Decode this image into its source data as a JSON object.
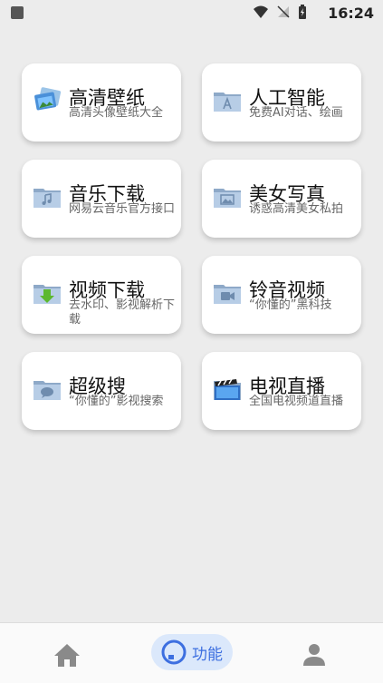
{
  "status": {
    "time": "16:24"
  },
  "cards": [
    {
      "title": "高清壁纸",
      "subtitle": "高清头像壁纸大全",
      "icon": "photos-icon"
    },
    {
      "title": "人工智能",
      "subtitle": "免费AI对话、绘画",
      "icon": "app-folder-icon"
    },
    {
      "title": "音乐下载",
      "subtitle": "网易云音乐官方接口",
      "icon": "music-folder-icon"
    },
    {
      "title": "美女写真",
      "subtitle": "诱惑高清美女私拍",
      "icon": "image-folder-icon"
    },
    {
      "title": "视频下载",
      "subtitle": "去水印、影视解析下载",
      "icon": "download-folder-icon"
    },
    {
      "title": "铃音视频",
      "subtitle": "“你懂的”黑科技",
      "icon": "video-folder-icon"
    },
    {
      "title": "超级搜",
      "subtitle": "“你懂的”影视搜索",
      "icon": "chat-folder-icon"
    },
    {
      "title": "电视直播",
      "subtitle": "全国电视频道直播",
      "icon": "clapper-folder-icon"
    }
  ],
  "bottom_nav": {
    "function_label": "功能",
    "accent": "#3d6fe0"
  }
}
